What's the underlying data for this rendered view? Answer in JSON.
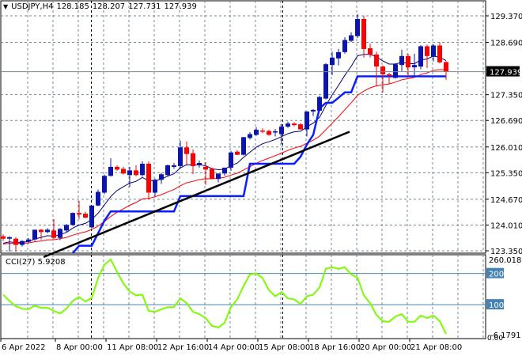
{
  "header": {
    "symbol": "USDJPY,H4",
    "open": "128.185",
    "high": "128.207",
    "low": "127.731",
    "close": "127.939"
  },
  "colors": {
    "bull": "#0a14b4",
    "bear": "#ff0000",
    "fast_ma": "#000080",
    "slow_ma": "#ff0000",
    "stop_line": "#0a1eff",
    "trendline": "#000000",
    "cci": "#7cfc00",
    "cci_levels": "#4682b4",
    "grid": "#778899"
  },
  "price_axis": {
    "labels": [
      "129.370",
      "128.690",
      "127.350",
      "126.690",
      "126.010",
      "125.350",
      "124.670",
      "124.010",
      "123.350"
    ],
    "current_price": "127.939"
  },
  "time_axis": {
    "labels": [
      {
        "text": "6 Apr 2022",
        "bar": 0
      },
      {
        "text": "8 Apr 00:00",
        "bar": 8
      },
      {
        "text": "11 Apr 08:00",
        "bar": 16
      },
      {
        "text": "12 Apr 16:00",
        "bar": 24
      },
      {
        "text": "14 Apr 00:00",
        "bar": 32
      },
      {
        "text": "15 Apr 08:00",
        "bar": 40
      },
      {
        "text": "18 Apr 16:00",
        "bar": 48
      },
      {
        "text": "20 Apr 00:00",
        "bar": 56
      },
      {
        "text": "21 Apr 08:00",
        "bar": 64
      }
    ]
  },
  "cci_panel": {
    "label": "CCI(27) 5.9208",
    "max_label": "260.0189",
    "min_label": "-6.1791",
    "zero_label": "0.00",
    "levels": [
      "200",
      "100"
    ]
  },
  "chart_data": {
    "type": "candlestick",
    "symbol": "USDJPY",
    "timeframe": "H4",
    "ylim": [
      123.35,
      129.37
    ],
    "ohlc": [
      [
        123.72,
        123.77,
        123.6,
        123.66
      ],
      [
        123.66,
        123.72,
        123.33,
        123.7
      ],
      [
        123.66,
        123.7,
        123.33,
        123.5
      ],
      [
        123.5,
        123.62,
        123.46,
        123.6
      ],
      [
        123.58,
        123.68,
        123.54,
        123.64
      ],
      [
        123.64,
        123.79,
        123.6,
        123.89
      ],
      [
        123.89,
        123.91,
        123.64,
        123.83
      ],
      [
        123.83,
        123.93,
        123.8,
        123.89
      ],
      [
        123.87,
        124.16,
        123.66,
        123.68
      ],
      [
        123.68,
        123.93,
        123.62,
        123.91
      ],
      [
        123.87,
        124.04,
        123.83,
        124.01
      ],
      [
        124.01,
        124.33,
        123.99,
        124.32
      ],
      [
        124.32,
        124.63,
        124.16,
        124.28
      ],
      [
        124.3,
        124.35,
        124.18,
        124.2
      ],
      [
        123.95,
        124.31,
        123.93,
        124.51
      ],
      [
        124.51,
        124.92,
        124.49,
        124.86
      ],
      [
        124.84,
        125.3,
        124.8,
        125.27
      ],
      [
        125.27,
        125.72,
        125.25,
        125.5
      ],
      [
        125.5,
        125.54,
        125.4,
        125.43
      ],
      [
        125.45,
        125.5,
        125.3,
        125.33
      ],
      [
        125.29,
        125.5,
        124.99,
        125.41
      ],
      [
        125.41,
        125.54,
        125.26,
        125.29
      ],
      [
        125.29,
        125.64,
        125.25,
        125.58
      ],
      [
        125.58,
        125.64,
        124.67,
        124.84
      ],
      [
        124.84,
        125.2,
        124.75,
        125.17
      ],
      [
        125.17,
        125.35,
        125.06,
        125.31
      ],
      [
        125.29,
        125.56,
        125.25,
        125.54
      ],
      [
        125.5,
        125.6,
        125.45,
        125.54
      ],
      [
        125.52,
        126.17,
        125.45,
        126.0
      ],
      [
        126.0,
        126.15,
        125.56,
        125.83
      ],
      [
        125.85,
        125.95,
        125.31,
        125.52
      ],
      [
        125.54,
        125.66,
        125.48,
        125.6
      ],
      [
        125.5,
        125.62,
        125.04,
        125.43
      ],
      [
        125.45,
        125.48,
        125.19,
        125.19
      ],
      [
        125.19,
        125.33,
        125.1,
        125.33
      ],
      [
        125.33,
        125.46,
        125.27,
        125.48
      ],
      [
        125.48,
        125.91,
        125.4,
        125.87
      ],
      [
        125.89,
        125.93,
        125.8,
        125.81
      ],
      [
        125.81,
        126.27,
        125.79,
        126.26
      ],
      [
        126.24,
        126.39,
        126.2,
        126.34
      ],
      [
        126.32,
        126.52,
        126.3,
        126.45
      ],
      [
        126.43,
        126.49,
        126.36,
        126.4
      ],
      [
        126.42,
        126.45,
        126.3,
        126.32
      ],
      [
        126.4,
        126.47,
        126.28,
        126.41
      ],
      [
        126.34,
        126.6,
        126.08,
        126.53
      ],
      [
        126.53,
        126.66,
        126.5,
        126.61
      ],
      [
        126.61,
        126.64,
        126.54,
        126.57
      ],
      [
        126.59,
        126.62,
        126.45,
        126.46
      ],
      [
        126.46,
        126.92,
        126.28,
        126.92
      ],
      [
        126.92,
        126.98,
        126.8,
        126.96
      ],
      [
        126.94,
        127.32,
        126.92,
        127.29
      ],
      [
        127.25,
        128.16,
        127.23,
        128.13
      ],
      [
        128.11,
        128.45,
        127.85,
        128.3
      ],
      [
        128.28,
        128.52,
        128.1,
        128.44
      ],
      [
        128.44,
        128.82,
        128.4,
        128.75
      ],
      [
        128.73,
        128.95,
        128.7,
        128.87
      ],
      [
        128.85,
        129.41,
        128.8,
        129.29
      ],
      [
        129.29,
        129.37,
        128.3,
        128.52
      ],
      [
        128.54,
        128.66,
        128.3,
        128.38
      ],
      [
        128.38,
        128.45,
        127.56,
        128.07
      ],
      [
        128.07,
        128.1,
        127.41,
        127.87
      ],
      [
        127.87,
        127.91,
        127.63,
        127.85
      ],
      [
        127.78,
        128.16,
        127.76,
        128.13
      ],
      [
        128.11,
        128.5,
        127.95,
        128.34
      ],
      [
        128.34,
        128.4,
        127.82,
        128.05
      ],
      [
        128.05,
        128.4,
        127.8,
        128.11
      ],
      [
        128.07,
        128.62,
        128.0,
        128.59
      ],
      [
        128.59,
        128.63,
        128.03,
        128.34
      ],
      [
        128.32,
        128.64,
        128.2,
        128.61
      ],
      [
        128.61,
        128.69,
        128.15,
        128.18
      ],
      [
        128.185,
        128.207,
        127.731,
        127.939
      ]
    ],
    "stop_line": [
      null,
      null,
      null,
      null,
      null,
      null,
      null,
      null,
      null,
      null,
      null,
      123.27,
      123.48,
      123.48,
      123.48,
      123.8,
      124.12,
      124.36,
      124.36,
      124.36,
      124.36,
      124.36,
      124.36,
      124.36,
      124.36,
      124.36,
      124.36,
      124.36,
      124.75,
      124.75,
      124.75,
      124.75,
      124.75,
      124.75,
      124.75,
      124.75,
      124.75,
      124.75,
      124.75,
      125.58,
      125.58,
      125.58,
      125.58,
      125.58,
      125.58,
      125.58,
      125.58,
      125.76,
      126.07,
      126.32,
      127.0,
      127.14,
      127.14,
      127.27,
      127.41,
      127.41,
      127.82,
      127.82,
      127.82,
      127.82,
      127.82,
      127.82,
      127.82,
      127.82,
      127.82,
      127.82,
      127.82,
      127.82,
      127.82,
      127.82,
      127.82
    ],
    "trendline": {
      "start": {
        "bar": 6.4,
        "price": 123.19
      },
      "end": {
        "bar": 54.75,
        "price": 126.4
      }
    },
    "separators": [
      13.9,
      44.1
    ],
    "cci": {
      "period": 27,
      "ylim": [
        -6.1791,
        260.0189
      ],
      "values": [
        132,
        112,
        95,
        87,
        85,
        97,
        90,
        90,
        80,
        72,
        87,
        112,
        125,
        110,
        122,
        185,
        228,
        245,
        205,
        168,
        142,
        130,
        132,
        80,
        77,
        85,
        92,
        92,
        120,
        105,
        77,
        70,
        57,
        32,
        27,
        42,
        92,
        117,
        160,
        197,
        200,
        185,
        147,
        127,
        140,
        120,
        117,
        102,
        127,
        132,
        155,
        215,
        220,
        215,
        220,
        197,
        187,
        130,
        105,
        67,
        47,
        45,
        62,
        70,
        45,
        45,
        65,
        57,
        65,
        47,
        6
      ]
    }
  }
}
